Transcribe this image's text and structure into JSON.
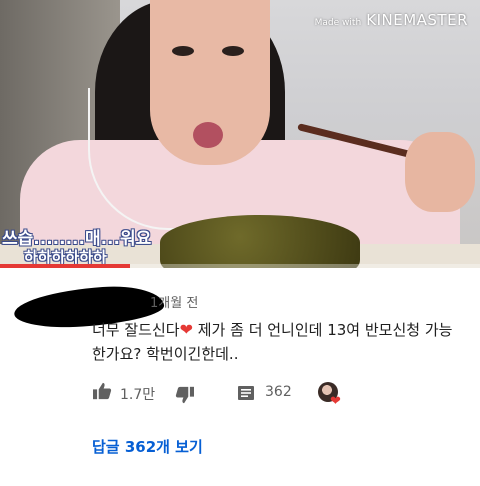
{
  "video": {
    "watermark_prefix": "Made with",
    "watermark_brand": "KINEMASTER",
    "caption_line1": "쓰습........매...워요",
    "caption_line2": "하하하하하하",
    "progress_fraction": 0.27,
    "progress_color": "#e53935"
  },
  "comment": {
    "timestamp": "1개월 전",
    "text_before_heart": "너무 잘드신다",
    "heart_glyph": "❤",
    "text_after_heart": " 제가 좀 더 언니인데 13여 반모신청 가능한가요? 학번이긴한데..",
    "like_icon": "thumbs-up-icon",
    "like_count": "1.7만",
    "dislike_icon": "thumbs-down-icon",
    "reply_icon": "comment-icon",
    "reply_count": "362",
    "creator_heart_icon": "creator-heart-icon",
    "view_replies": "답글 362개 보기",
    "link_color": "#065fd4"
  }
}
